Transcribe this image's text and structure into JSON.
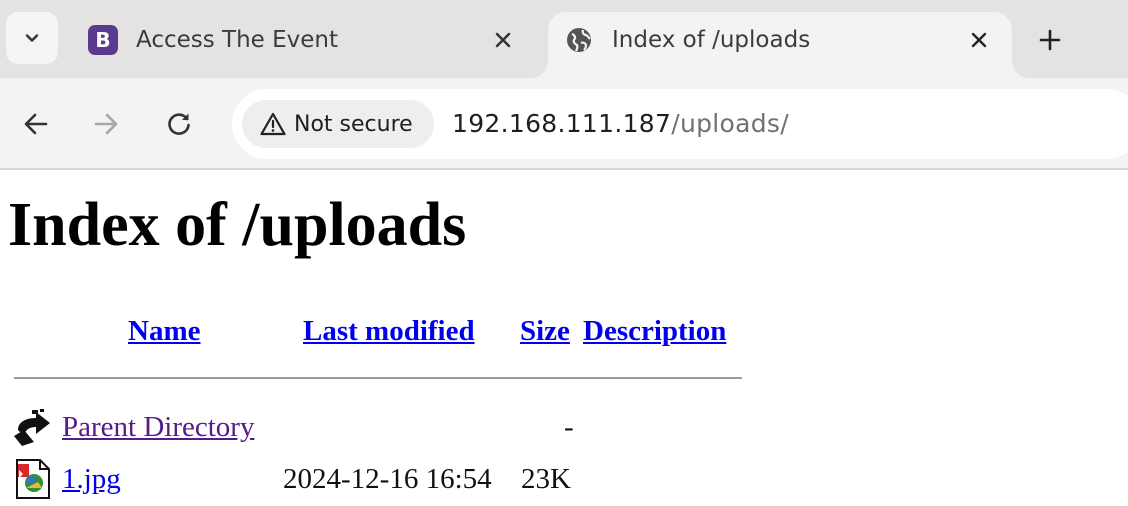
{
  "browser": {
    "tabs": [
      {
        "title": "Access The Event",
        "favicon": "bootstrap-logo-icon",
        "favicon_letter": "B",
        "active": false
      },
      {
        "title": "Index of /uploads",
        "favicon": "globe-icon",
        "active": true
      }
    ],
    "toolbar": {
      "security_label": "Not secure",
      "url_host": "192.168.111.187",
      "url_path": "/uploads/"
    }
  },
  "page": {
    "title": "Index of /uploads",
    "columns": {
      "name": "Name",
      "last_modified": "Last modified",
      "size": "Size",
      "description": "Description"
    },
    "rows": [
      {
        "icon": "parent-directory-icon",
        "name": "Parent Directory",
        "last_modified": "",
        "size": "-",
        "description": "",
        "visited": true
      },
      {
        "icon": "image-file-icon",
        "name": "1.jpg",
        "last_modified": "2024-12-16 16:54",
        "size": "23K",
        "description": "",
        "visited": false
      }
    ]
  },
  "colors": {
    "link": "#0000ee",
    "visited_link": "#551a8b",
    "tabstrip_bg": "#e4e3e2",
    "toolbar_bg": "#f3f3f3"
  }
}
